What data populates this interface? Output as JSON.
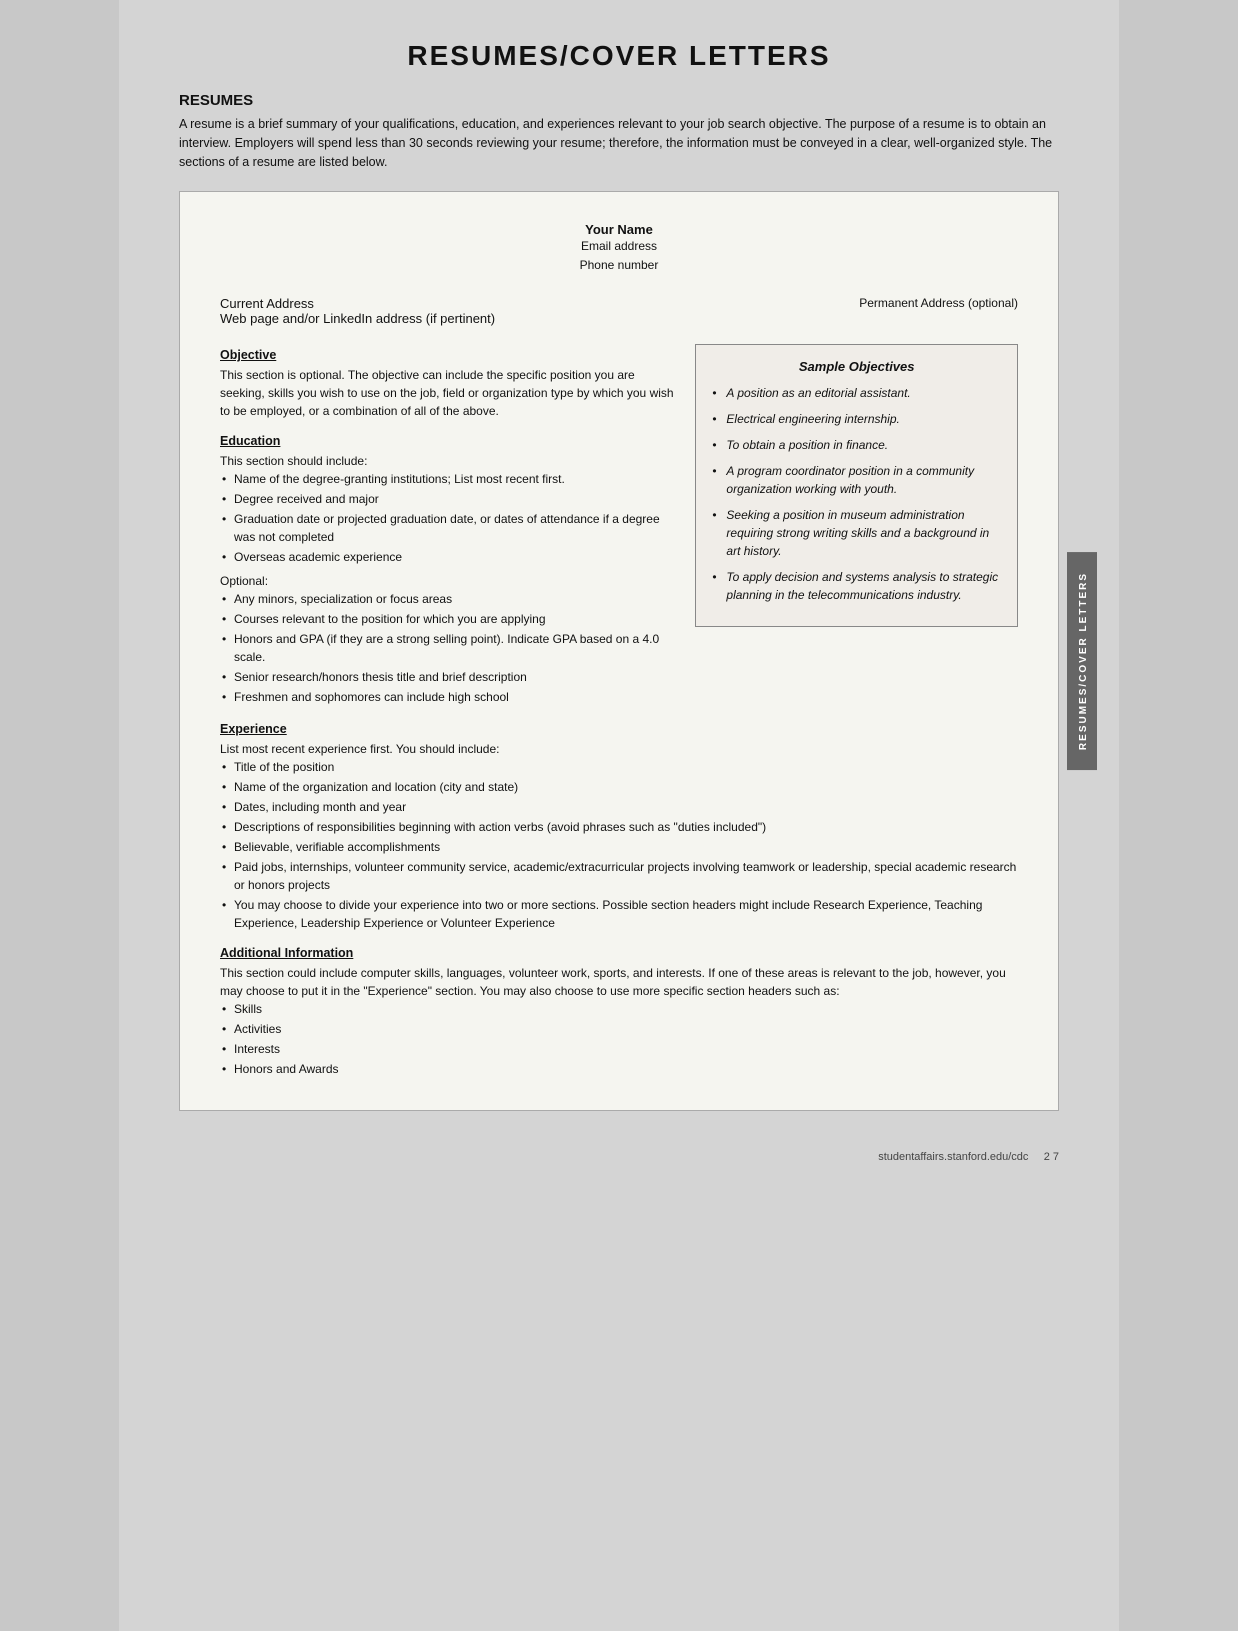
{
  "page": {
    "title": "RESUMES/COVER LETTERS",
    "footer_url": "studentaffairs.stanford.edu/cdc",
    "footer_page": "2  7"
  },
  "resumes_section": {
    "heading": "RESUMES",
    "intro": "A resume is a brief summary of your qualifications, education, and experiences relevant to your job search objective. The purpose of a resume is to obtain an interview. Employers will spend less than 30 seconds reviewing your resume; therefore, the information must be conveyed in a clear, well-organized style. The sections of a resume are listed below."
  },
  "resume_doc": {
    "name": "Your Name",
    "email": "Email address",
    "phone": "Phone number",
    "address_left": "Current Address",
    "address_left2": "Web page and/or LinkedIn address (if pertinent)",
    "address_right": "Permanent Address (optional)",
    "objective_title": "Objective",
    "objective_text": "This section is optional. The objective can include the specific position you are seeking, skills you wish to use on the job, field or organization type by which you wish to be employed, or a combination of all of the above.",
    "education_title": "Education",
    "education_intro": "This section should include:",
    "education_bullets": [
      "Name of the degree-granting institutions; List most recent first.",
      "Degree received and major",
      "Graduation date or projected graduation date, or dates of attendance if a degree was not completed",
      "Overseas academic experience"
    ],
    "optional_label": "Optional:",
    "optional_bullets": [
      "Any minors, specialization or focus areas",
      "Courses relevant to the position for which you are applying",
      "Honors and GPA (if they are a strong selling point). Indicate GPA based on a 4.0 scale.",
      "Senior research/honors thesis title and brief description",
      "Freshmen and sophomores can include high school"
    ],
    "experience_title": "Experience",
    "experience_intro": "List most recent experience first. You should include:",
    "experience_bullets": [
      "Title of the position",
      "Name of the organization and location (city and state)",
      "Dates, including month and year",
      "Descriptions of responsibilities beginning with action verbs (avoid phrases such as \"duties included\")",
      "Believable, verifiable accomplishments",
      "Paid jobs, internships, volunteer community service, academic/extracurricular projects involving teamwork or leadership, special academic research or honors projects",
      "You may choose to divide your experience into two or more sections. Possible section headers might include Research Experience, Teaching Experience, Leadership Experience or Volunteer Experience"
    ],
    "additional_title": "Additional Information",
    "additional_intro": "This section could include computer skills, languages, volunteer work, sports, and interests. If one of these areas is relevant to the job, however, you may choose to put it in the \"Experience\" section. You may also choose to use more specific section headers such as:",
    "additional_bullets": [
      "Skills",
      "Activities",
      "Interests",
      "Honors and Awards"
    ]
  },
  "sample_objectives": {
    "title": "Sample Objectives",
    "items": [
      "A position as an editorial assistant.",
      "Electrical engineering internship.",
      "To obtain a position in finance.",
      "A program coordinator position in a community organization working with youth.",
      "Seeking a position in museum administration requiring strong writing skills and a background in art history.",
      "To apply decision and systems analysis to strategic planning in the telecommunications industry."
    ]
  },
  "side_tab": {
    "text": "RESUMES/COVER LETTERS"
  }
}
